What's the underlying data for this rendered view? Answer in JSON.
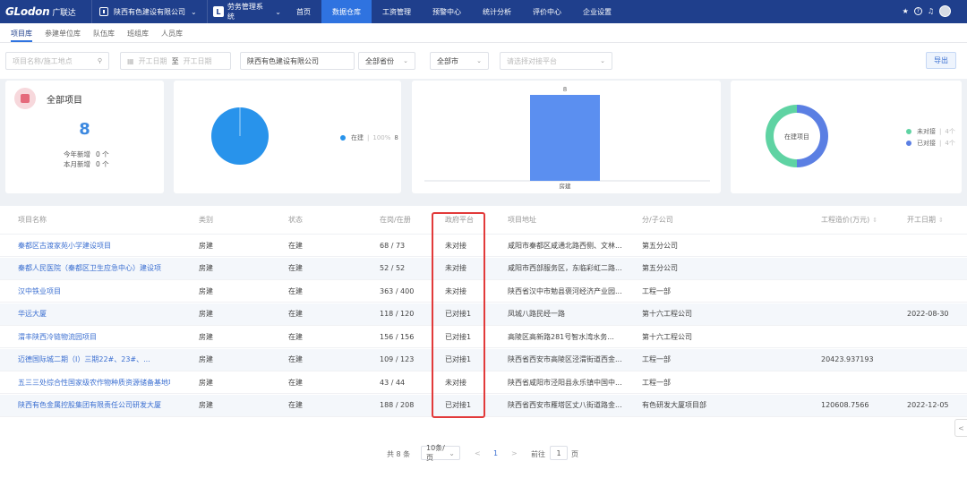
{
  "app": {
    "logo": "GLodon",
    "logo_cn": "广联达",
    "org": "陕西有色建设有限公司",
    "system": "劳务管理系统",
    "system_icon": "L"
  },
  "nav": [
    "首页",
    "数据仓库",
    "工资管理",
    "预警中心",
    "统计分析",
    "评价中心",
    "企业设置"
  ],
  "subtabs": [
    "项目库",
    "参建单位库",
    "队伍库",
    "班组库",
    "人员库"
  ],
  "filters": {
    "search_placeholder": "项目名称/施工地点",
    "date_start": "开工日期",
    "date_to": "至",
    "date_end": "开工日期",
    "company": "陕西有色建设有限公司",
    "province": "全部省份",
    "city": "全部市",
    "platform_placeholder": "请选择对接平台",
    "export": "导出"
  },
  "summary": {
    "title": "全部项目",
    "total": "8",
    "new_year_label": "今年新增",
    "new_year_value": "0 个",
    "new_month_label": "本月新增",
    "new_month_value": "0 个"
  },
  "chart_data": [
    {
      "type": "pie",
      "categories": [
        "在建"
      ],
      "values": [
        100
      ],
      "legend": [
        {
          "label": "在建",
          "percent": "100%",
          "count": "8"
        }
      ]
    },
    {
      "type": "bar",
      "categories": [
        "房建"
      ],
      "values": [
        8
      ],
      "data_labels": [
        "8"
      ]
    },
    {
      "type": "pie",
      "donut": true,
      "center_label": "在建项目",
      "categories": [
        "未对接",
        "已对接"
      ],
      "values": [
        4,
        4
      ],
      "legend": [
        {
          "label": "未对接",
          "count": "4个"
        },
        {
          "label": "已对接",
          "count": "4个"
        }
      ]
    }
  ],
  "colors": {
    "nav_bg": "#1f3f8c",
    "nav_active": "#2f73e0",
    "pie": "#2893eb",
    "bar": "#5b8ff0",
    "donut_a": "#5fd3a3",
    "donut_b": "#5b7fe3",
    "highlight": "#e23a3a"
  },
  "table": {
    "headers": [
      "项目名称",
      "类别",
      "状态",
      "在岗/在册",
      "政府平台",
      "项目地址",
      "分/子公司",
      "工程造价(万元)",
      "开工日期"
    ],
    "rows": [
      [
        "秦都区古渡家苑小学建设项目",
        "房建",
        "在建",
        "68 / 73",
        "未对接",
        "咸阳市秦都区咸通北路西侧、文林...",
        "第五分公司",
        "",
        ""
      ],
      [
        "秦都人民医院（秦都区卫生应急中心）建设项",
        "房建",
        "在建",
        "52 / 52",
        "未对接",
        "咸阳市西部服务区，东临彩虹二路...",
        "第五分公司",
        "",
        ""
      ],
      [
        "汉中铁业项目",
        "房建",
        "在建",
        "363 / 400",
        "未对接",
        "陕西省汉中市勉县褒河经济产业园...",
        "工程一部",
        "",
        ""
      ],
      [
        "华远大厦",
        "房建",
        "在建",
        "118 / 120",
        "已对接1",
        "凤城八路民经一路",
        "第十六工程公司",
        "",
        "2022-08-30"
      ],
      [
        "渭丰陕西冷链物流园项目",
        "房建",
        "在建",
        "156 / 156",
        "已对接1",
        "高陵区高新路281号智水湾水务...",
        "第十六工程公司",
        "",
        ""
      ],
      [
        "迈德国际城二期（I）三期22#、23#、...",
        "房建",
        "在建",
        "109 / 123",
        "已对接1",
        "陕西省西安市高陵区泾渭街道西金...",
        "工程一部",
        "20423.937193",
        ""
      ],
      [
        "五三三处综合性国家级农作物种质资源储备基地项目",
        "房建",
        "在建",
        "43 / 44",
        "未对接",
        "陕西省咸阳市泾阳县永乐镇中国中...",
        "工程一部",
        "",
        ""
      ],
      [
        "陕西有色金属控股集团有限责任公司研发大厦",
        "房建",
        "在建",
        "188 / 208",
        "已对接1",
        "陕西省西安市雁塔区丈八街道路金...",
        "有色研发大厦项目部",
        "120608.7566",
        "2022-12-05"
      ]
    ]
  },
  "pager": {
    "total": "共 8 条",
    "page_size": "10条/页",
    "current": "1",
    "goto_label": "前往",
    "goto_value": "1",
    "page_unit": "页"
  }
}
